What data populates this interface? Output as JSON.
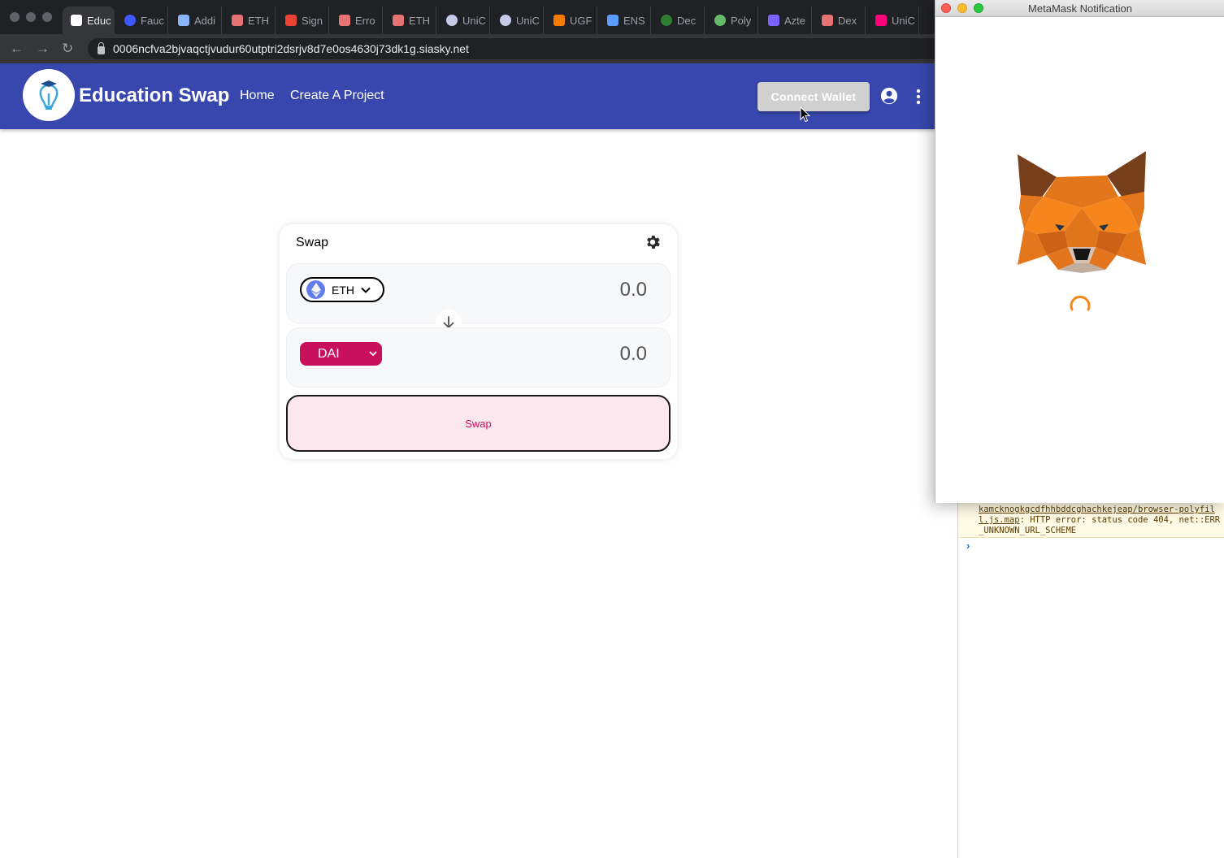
{
  "browser": {
    "tabs": [
      {
        "label": "Educ",
        "icon": "education-swap-favicon",
        "color": "#ffffff",
        "active": true
      },
      {
        "label": "Fauc",
        "icon": "faucet-favicon",
        "color": "#3d5afe"
      },
      {
        "label": "Addi",
        "icon": "moon-favicon",
        "color": "#8ab4f8"
      },
      {
        "label": "ETH",
        "icon": "rainbow-favicon",
        "color": "#e57373"
      },
      {
        "label": "Sign",
        "icon": "gmail-favicon",
        "color": "#ea4335"
      },
      {
        "label": "Erro",
        "icon": "rainbow-favicon",
        "color": "#e57373"
      },
      {
        "label": "ETH",
        "icon": "rainbow-favicon",
        "color": "#e57373"
      },
      {
        "label": "UniC",
        "icon": "circle-favicon",
        "color": "#c5cae9"
      },
      {
        "label": "UniC",
        "icon": "circle-favicon",
        "color": "#c5cae9"
      },
      {
        "label": "UGF",
        "icon": "cube-favicon",
        "color": "#f57c00"
      },
      {
        "label": "ENS",
        "icon": "code-favicon",
        "color": "#5c9cff"
      },
      {
        "label": "Dec",
        "icon": "green-ring-favicon",
        "color": "#2e7d32"
      },
      {
        "label": "Poly",
        "icon": "globe-favicon",
        "color": "#66bb6a"
      },
      {
        "label": "Azte",
        "icon": "diamond-favicon",
        "color": "#7b61ff"
      },
      {
        "label": "Dex",
        "icon": "rainbow-favicon",
        "color": "#e57373"
      },
      {
        "label": "UniC",
        "icon": "unicorn-favicon",
        "color": "#ff007a"
      }
    ],
    "url": "0006ncfva2bjvaqctjvudur60utptri2dsrjv8d7e0os4630j73dk1g.siasky.net",
    "back_glyph": "←",
    "forward_glyph": "→",
    "reload_glyph": "↻"
  },
  "header": {
    "title": "Education Swap",
    "nav": [
      "Home",
      "Create A Project"
    ],
    "connect_label": "Connect Wallet",
    "brand_color": "#3747ad"
  },
  "swap": {
    "title": "Swap",
    "from_token": "ETH",
    "from_amount": "0.0",
    "to_token": "DAI",
    "to_amount": "0.0",
    "button_label": "Swap",
    "accent_color": "#c8105c"
  },
  "devtools": {
    "link_text": "kamcknogkgcdfhhbddcghachkejeap/browser-polyfill.js.map",
    "message": ": HTTP error: status code 404, net::ERR_UNKNOWN_URL_SCHEME",
    "prompt": "›"
  },
  "metamask": {
    "window_title": "MetaMask Notification"
  }
}
